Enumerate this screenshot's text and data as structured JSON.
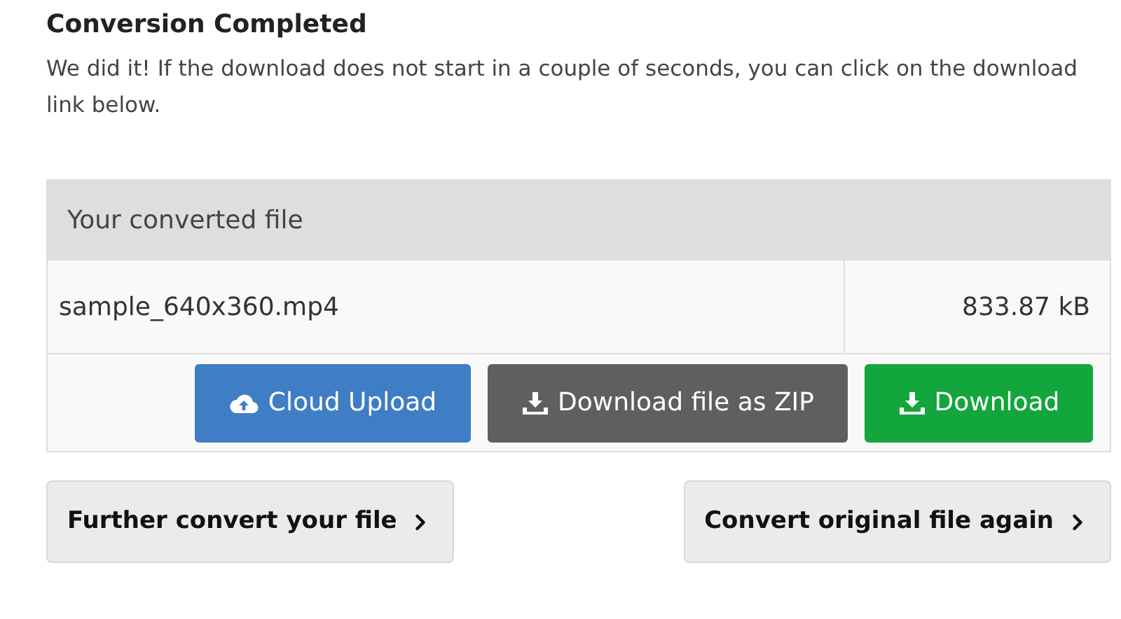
{
  "heading": "Conversion Completed",
  "message": "We did it! If the download does not start in a couple of seconds, you can click on the download link below.",
  "table": {
    "header": "Your converted file",
    "file_name": "sample_640x360.mp4",
    "file_size": "833.87 kB",
    "actions": [
      {
        "kind": "cloud",
        "label": "Cloud Upload"
      },
      {
        "kind": "zip",
        "label": "Download file as ZIP"
      },
      {
        "kind": "download",
        "label": "Download"
      }
    ]
  },
  "links": [
    "Further convert your file",
    "Convert original file again"
  ]
}
